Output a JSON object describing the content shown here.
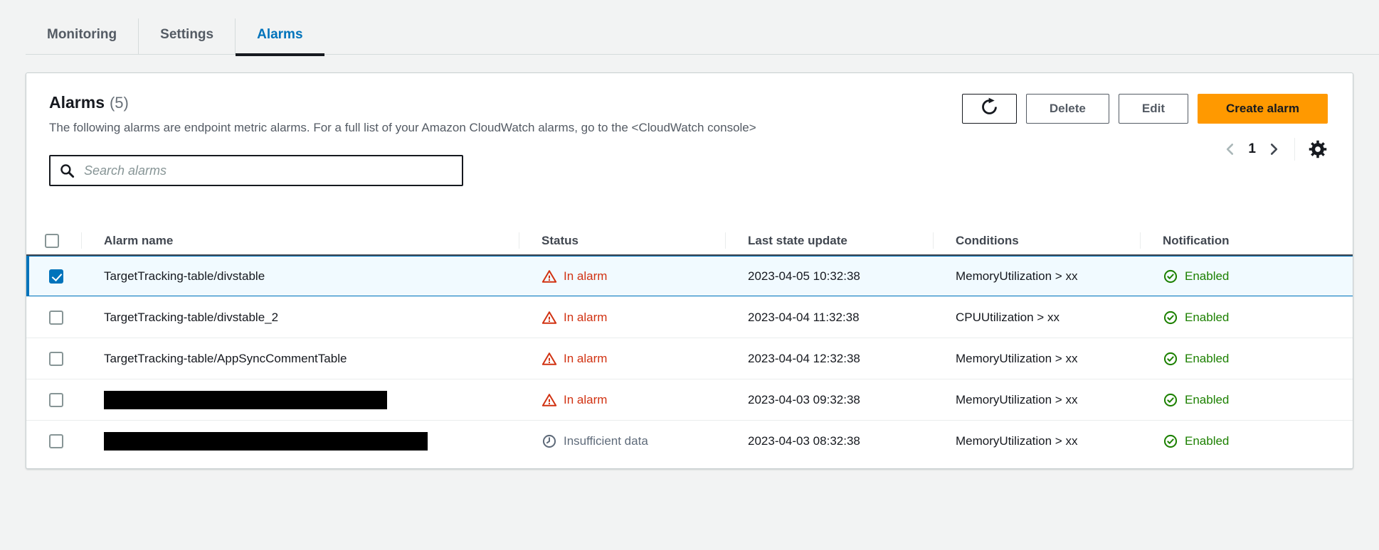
{
  "tabs": [
    {
      "label": "Monitoring",
      "active": false
    },
    {
      "label": "Settings",
      "active": false
    },
    {
      "label": "Alarms",
      "active": true
    }
  ],
  "panel": {
    "title": "Alarms",
    "count": "(5)",
    "description": "The following alarms are endpoint metric alarms. For a full list of your Amazon CloudWatch alarms, go to the <CloudWatch console>",
    "actions": {
      "refresh_icon": "refresh-icon",
      "delete_label": "Delete",
      "edit_label": "Edit",
      "create_label": "Create alarm"
    },
    "pagination": {
      "prev_icon": "chevron-left-icon",
      "current_page": "1",
      "next_icon": "chevron-right-icon",
      "settings_icon": "gear-icon"
    },
    "search": {
      "placeholder": "Search alarms",
      "icon": "search-icon"
    },
    "table": {
      "columns": [
        "Alarm name",
        "Status",
        "Last state update",
        "Conditions",
        "Notification"
      ],
      "rows": [
        {
          "name": "TargetTracking-table/divstable",
          "redacted": false,
          "redaction_width": 0,
          "selected": true,
          "status": "In alarm",
          "status_type": "alarm",
          "last_state_update": "2023-04-05 10:32:38",
          "condition": "MemoryUtilization > xx",
          "notification": "Enabled"
        },
        {
          "name": "TargetTracking-table/divstable_2",
          "redacted": false,
          "redaction_width": 0,
          "selected": false,
          "status": "In alarm",
          "status_type": "alarm",
          "last_state_update": "2023-04-04 11:32:38",
          "condition": "CPUUtilization > xx",
          "notification": "Enabled"
        },
        {
          "name": "TargetTracking-table/AppSyncCommentTable",
          "redacted": false,
          "redaction_width": 0,
          "selected": false,
          "status": "In alarm",
          "status_type": "alarm",
          "last_state_update": "2023-04-04 12:32:38",
          "condition": "MemoryUtilization > xx",
          "notification": "Enabled"
        },
        {
          "name": "",
          "redacted": true,
          "redaction_width": 398,
          "selected": false,
          "status": "In alarm",
          "status_type": "alarm",
          "last_state_update": "2023-04-03 09:32:38",
          "condition": "MemoryUtilization > xx",
          "notification": "Enabled"
        },
        {
          "name": "",
          "redacted": true,
          "redaction_width": 455,
          "selected": false,
          "status": "Insufficient data",
          "status_type": "insufficient",
          "last_state_update": "2023-04-03 08:32:38",
          "condition": "MemoryUtilization > xx",
          "notification": "Enabled"
        }
      ]
    }
  },
  "colors": {
    "accent_blue": "#0073bb",
    "primary_orange": "#ff9900",
    "alarm_red": "#d13212",
    "enabled_green": "#1d8102",
    "insufficient_gray": "#5f6b7a",
    "selected_row_bg": "#f1faff",
    "active_tab_underline": "#16191f"
  }
}
